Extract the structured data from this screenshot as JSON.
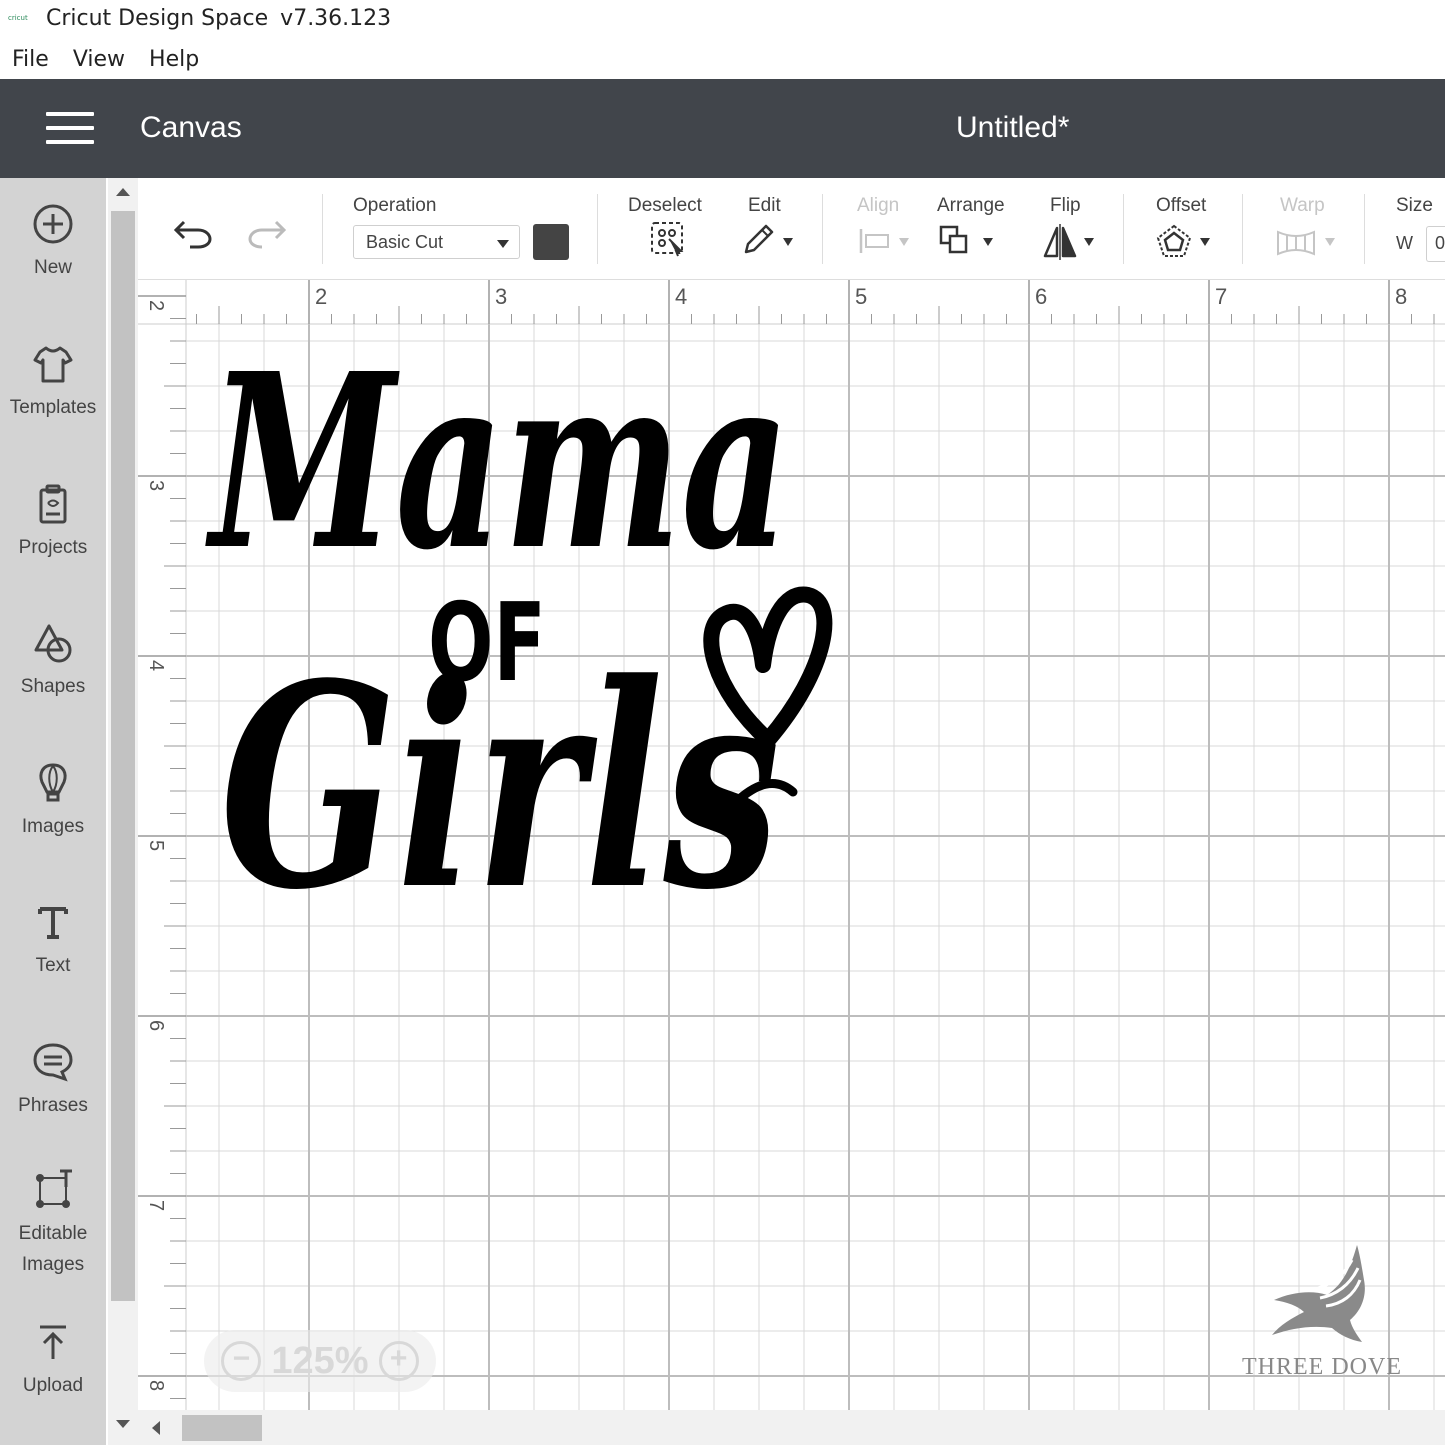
{
  "window": {
    "app_title": "Cricut Design Space",
    "version": "v7.36.123",
    "logo_text": "cricut"
  },
  "menu": [
    "File",
    "View",
    "Help"
  ],
  "header": {
    "section": "Canvas",
    "project_name": "Untitled*"
  },
  "sidebar": {
    "items": [
      {
        "label": "New",
        "icon": "plus-circle-icon"
      },
      {
        "label": "Templates",
        "icon": "tshirt-icon"
      },
      {
        "label": "Projects",
        "icon": "clipboard-icon"
      },
      {
        "label": "Shapes",
        "icon": "shapes-icon"
      },
      {
        "label": "Images",
        "icon": "lightbulb-icon"
      },
      {
        "label": "Text",
        "icon": "text-icon"
      },
      {
        "label": "Phrases",
        "icon": "speech-bubble-icon"
      },
      {
        "label": "Editable\nImages",
        "line1": "Editable",
        "line2": "Images",
        "icon": "editable-images-icon"
      },
      {
        "label": "Upload",
        "icon": "upload-icon"
      }
    ]
  },
  "toolbar": {
    "operation_label": "Operation",
    "operation_value": "Basic Cut",
    "operation_color": "#444444",
    "deselect_label": "Deselect",
    "edit_label": "Edit",
    "align_label": "Align",
    "arrange_label": "Arrange",
    "flip_label": "Flip",
    "offset_label": "Offset",
    "warp_label": "Warp",
    "size_label": "Size",
    "size_w_label": "W",
    "size_w_value": "0"
  },
  "ruler": {
    "horizontal": [
      "2",
      "3",
      "4",
      "5",
      "6",
      "7",
      "8"
    ],
    "vertical": [
      "2",
      "3",
      "4",
      "5",
      "6",
      "7",
      "8"
    ]
  },
  "canvas": {
    "design_text": [
      "Mama",
      "OF",
      "Girls"
    ],
    "design_color": "#000000"
  },
  "zoom": {
    "minus": "−",
    "value": "125%",
    "plus": "+"
  },
  "watermark": "THREE DOVE"
}
